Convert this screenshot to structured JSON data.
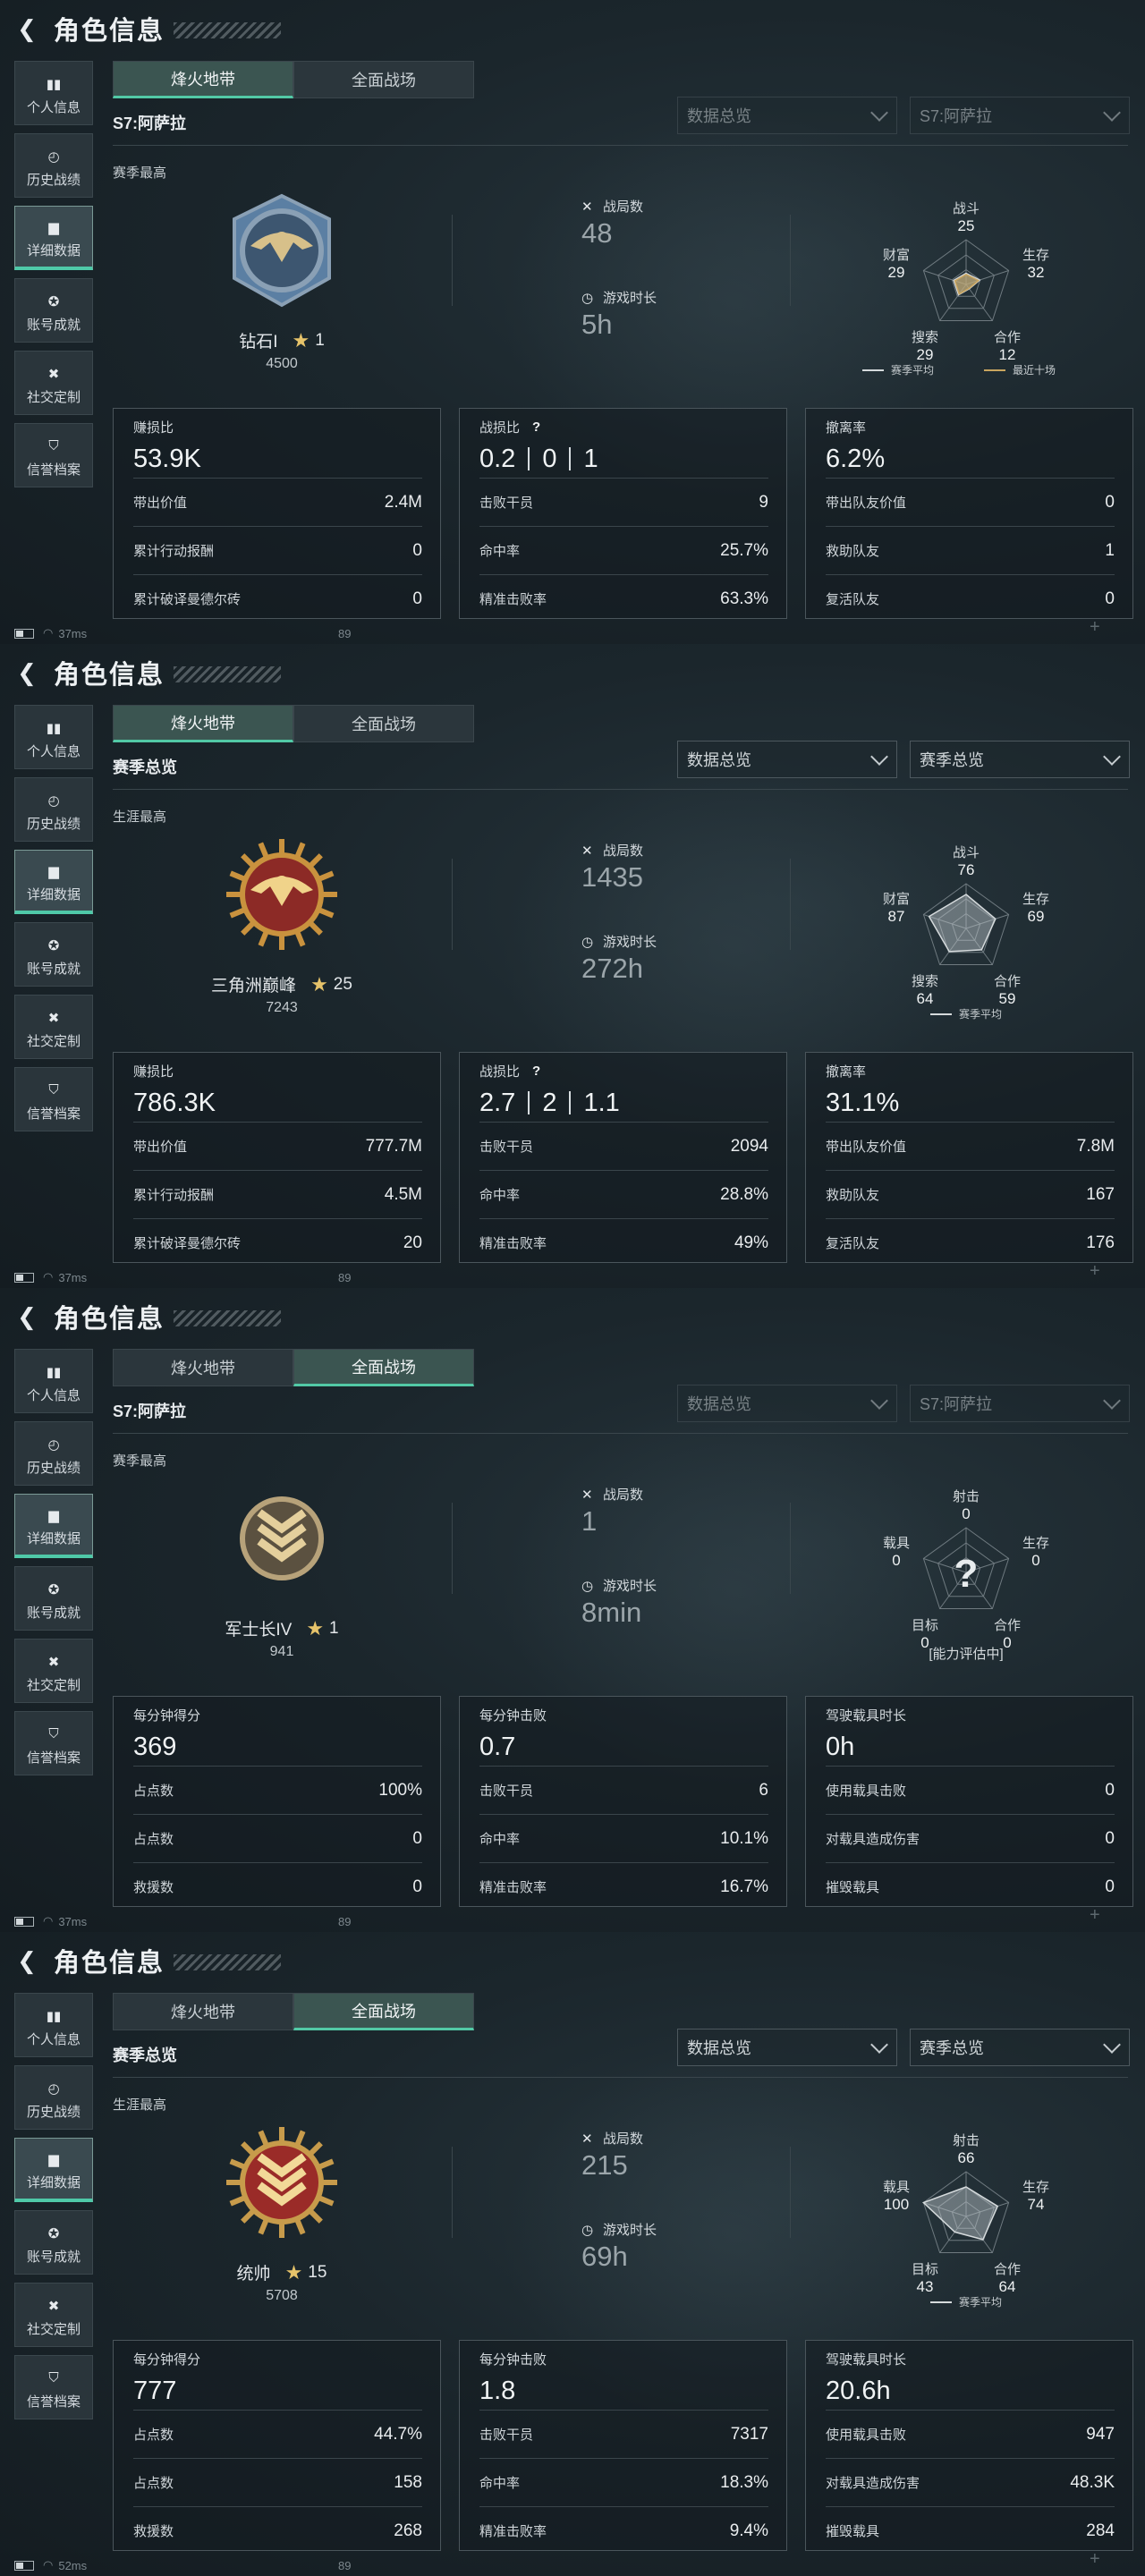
{
  "colors": {
    "accent": "#4fc9a8",
    "panel_bg": "#1b262c",
    "star": "#e6c36a",
    "radar_line_recent": "#c9a55f"
  },
  "header": {
    "title": "角色信息",
    "back_icon": "back-arrow-icon"
  },
  "sidebar": {
    "items": [
      {
        "label": "个人信息",
        "icon": "bar-chart-icon"
      },
      {
        "label": "历史战绩",
        "icon": "clock-icon"
      },
      {
        "label": "详细数据",
        "icon": "folder-icon"
      },
      {
        "label": "账号成就",
        "icon": "medal-icon"
      },
      {
        "label": "社交定制",
        "icon": "tools-icon"
      },
      {
        "label": "信誉档案",
        "icon": "shield-icon"
      }
    ],
    "active": "详细数据"
  },
  "tabs": [
    "烽火地带",
    "全面战场"
  ],
  "panels": [
    {
      "active_tab": "烽火地带",
      "season_label": "S7:阿萨拉",
      "dropdowns_dim": true,
      "dropdowns": [
        "数据总览",
        "S7:阿萨拉"
      ],
      "best_label": "赛季最高",
      "rank": {
        "name": "钻石I",
        "stars": "1",
        "points": "4500",
        "badge": "diamond"
      },
      "matches_label": "战局数",
      "matches": "48",
      "time_label": "游戏时长",
      "time": "5h",
      "radar": {
        "labels": [
          "战斗",
          "生存",
          "合作",
          "搜索",
          "财富"
        ],
        "values": [
          "25",
          "32",
          "12",
          "29",
          "29"
        ],
        "scores": [
          25,
          32,
          12,
          29,
          29
        ],
        "legend": [
          "赛季平均",
          "最近十场"
        ],
        "unknown": false
      },
      "cards": [
        {
          "title": "赚损比",
          "big": [
            "53.9K"
          ],
          "rows": [
            [
              "带出价值",
              "2.4M"
            ],
            [
              "累计行动报酬",
              "0"
            ],
            [
              "累计破译曼德尔砖",
              "0"
            ]
          ]
        },
        {
          "title": "战损比",
          "help": "?",
          "big": [
            "0.2",
            "0",
            "1"
          ],
          "rows": [
            [
              "击败干员",
              "9"
            ],
            [
              "命中率",
              "25.7%"
            ],
            [
              "精准击败率",
              "63.3%"
            ]
          ]
        },
        {
          "title": "撤离率",
          "big": [
            "6.2%"
          ],
          "rows": [
            [
              "带出队友价值",
              "0"
            ],
            [
              "救助队友",
              "1"
            ],
            [
              "复活队友",
              "0"
            ]
          ]
        }
      ],
      "status": {
        "ping": "37ms",
        "fps": "89"
      }
    },
    {
      "active_tab": "烽火地带",
      "season_label": "赛季总览",
      "dropdowns_dim": false,
      "dropdowns": [
        "数据总览",
        "赛季总览"
      ],
      "best_label": "生涯最高",
      "rank": {
        "name": "三角洲巅峰",
        "stars": "25",
        "points": "7243",
        "badge": "peak"
      },
      "matches_label": "战局数",
      "matches": "1435",
      "time_label": "游戏时长",
      "time": "272h",
      "radar": {
        "labels": [
          "战斗",
          "生存",
          "合作",
          "搜索",
          "财富"
        ],
        "values": [
          "76",
          "69",
          "59",
          "64",
          "87"
        ],
        "scores": [
          76,
          69,
          59,
          64,
          87
        ],
        "legend": [
          "赛季平均"
        ],
        "unknown": false
      },
      "cards": [
        {
          "title": "赚损比",
          "big": [
            "786.3K"
          ],
          "rows": [
            [
              "带出价值",
              "777.7M"
            ],
            [
              "累计行动报酬",
              "4.5M"
            ],
            [
              "累计破译曼德尔砖",
              "20"
            ]
          ]
        },
        {
          "title": "战损比",
          "help": "?",
          "big": [
            "2.7",
            "2",
            "1.1"
          ],
          "rows": [
            [
              "击败干员",
              "2094"
            ],
            [
              "命中率",
              "28.8%"
            ],
            [
              "精准击败率",
              "49%"
            ]
          ]
        },
        {
          "title": "撤离率",
          "big": [
            "31.1%"
          ],
          "rows": [
            [
              "带出队友价值",
              "7.8M"
            ],
            [
              "救助队友",
              "167"
            ],
            [
              "复活队友",
              "176"
            ]
          ]
        }
      ],
      "status": {
        "ping": "37ms",
        "fps": "89"
      }
    },
    {
      "active_tab": "全面战场",
      "season_label": "S7:阿萨拉",
      "dropdowns_dim": true,
      "dropdowns": [
        "数据总览",
        "S7:阿萨拉"
      ],
      "best_label": "赛季最高",
      "rank": {
        "name": "军士长IV",
        "stars": "1",
        "points": "941",
        "badge": "sergeant"
      },
      "matches_label": "战局数",
      "matches": "1",
      "time_label": "游戏时长",
      "time": "8min",
      "radar": {
        "labels": [
          "射击",
          "生存",
          "合作",
          "目标",
          "载具"
        ],
        "values": [
          "0",
          "0",
          "0",
          "0",
          "0"
        ],
        "scores": [
          0,
          0,
          0,
          0,
          0
        ],
        "legend": [],
        "unknown": true,
        "unknown_mark": "?",
        "note": "[能力评估中]"
      },
      "cards": [
        {
          "title": "每分钟得分",
          "big": [
            "369"
          ],
          "rows": [
            [
              "占点数",
              "100%"
            ],
            [
              "占点数",
              "0"
            ],
            [
              "救援数",
              "0"
            ]
          ]
        },
        {
          "title": "每分钟击败",
          "big": [
            "0.7"
          ],
          "rows": [
            [
              "击败干员",
              "6"
            ],
            [
              "命中率",
              "10.1%"
            ],
            [
              "精准击败率",
              "16.7%"
            ]
          ]
        },
        {
          "title": "驾驶载具时长",
          "big": [
            "0h"
          ],
          "rows": [
            [
              "使用载具击败",
              "0"
            ],
            [
              "对载具造成伤害",
              "0"
            ],
            [
              "摧毁载具",
              "0"
            ]
          ]
        }
      ],
      "status": {
        "ping": "37ms",
        "fps": "89"
      }
    },
    {
      "active_tab": "全面战场",
      "season_label": "赛季总览",
      "dropdowns_dim": false,
      "dropdowns": [
        "数据总览",
        "赛季总览"
      ],
      "best_label": "生涯最高",
      "rank": {
        "name": "统帅",
        "stars": "15",
        "points": "5708",
        "badge": "marshal"
      },
      "matches_label": "战局数",
      "matches": "215",
      "time_label": "游戏时长",
      "time": "69h",
      "radar": {
        "labels": [
          "射击",
          "生存",
          "合作",
          "目标",
          "载具"
        ],
        "values": [
          "66",
          "74",
          "64",
          "43",
          "100"
        ],
        "scores": [
          66,
          74,
          64,
          43,
          100
        ],
        "legend": [
          "赛季平均"
        ],
        "unknown": false
      },
      "cards": [
        {
          "title": "每分钟得分",
          "big": [
            "777"
          ],
          "rows": [
            [
              "占点数",
              "44.7%"
            ],
            [
              "占点数",
              "158"
            ],
            [
              "救援数",
              "268"
            ]
          ]
        },
        {
          "title": "每分钟击败",
          "big": [
            "1.8"
          ],
          "rows": [
            [
              "击败干员",
              "7317"
            ],
            [
              "命中率",
              "18.3%"
            ],
            [
              "精准击败率",
              "9.4%"
            ]
          ]
        },
        {
          "title": "驾驶载具时长",
          "big": [
            "20.6h"
          ],
          "rows": [
            [
              "使用载具击败",
              "947"
            ],
            [
              "对载具造成伤害",
              "48.3K"
            ],
            [
              "摧毁载具",
              "284"
            ]
          ]
        }
      ],
      "status": {
        "ping": "52ms",
        "fps": "89"
      }
    }
  ]
}
